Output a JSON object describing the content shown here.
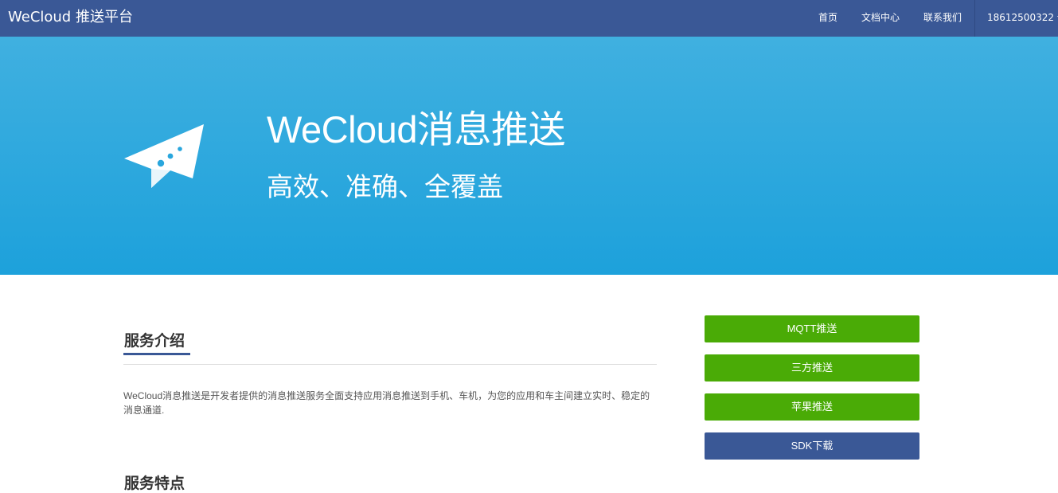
{
  "navbar": {
    "brand": "WeCloud 推送平台",
    "links": [
      "首页",
      "文档中心",
      "联系我们"
    ],
    "user": "18612500322"
  },
  "hero": {
    "icon": "paper-plane-icon",
    "title": "WeCloud消息推送",
    "subtitle": "高效、准确、全覆盖"
  },
  "main": {
    "section_title": "服务介绍",
    "intro_text": "WeCloud消息推送是开发者提供的消息推送服务全面支持应用消息推送到手机、车机，为您的应用和车主间建立实时、稳定的消息通道.",
    "section_title_2": "服务特点"
  },
  "sidebar": {
    "buttons": [
      {
        "label": "MQTT推送",
        "color": "#4aab06"
      },
      {
        "label": "三方推送",
        "color": "#4aab06"
      },
      {
        "label": "苹果推送",
        "color": "#4aab06"
      },
      {
        "label": "SDK下载",
        "color": "#3a5896"
      }
    ]
  },
  "colors": {
    "navbar": "#3a5896",
    "hero_top": "#40b0e0",
    "hero_bottom": "#1da1db",
    "green": "#4aab06",
    "blue": "#3a5896"
  }
}
